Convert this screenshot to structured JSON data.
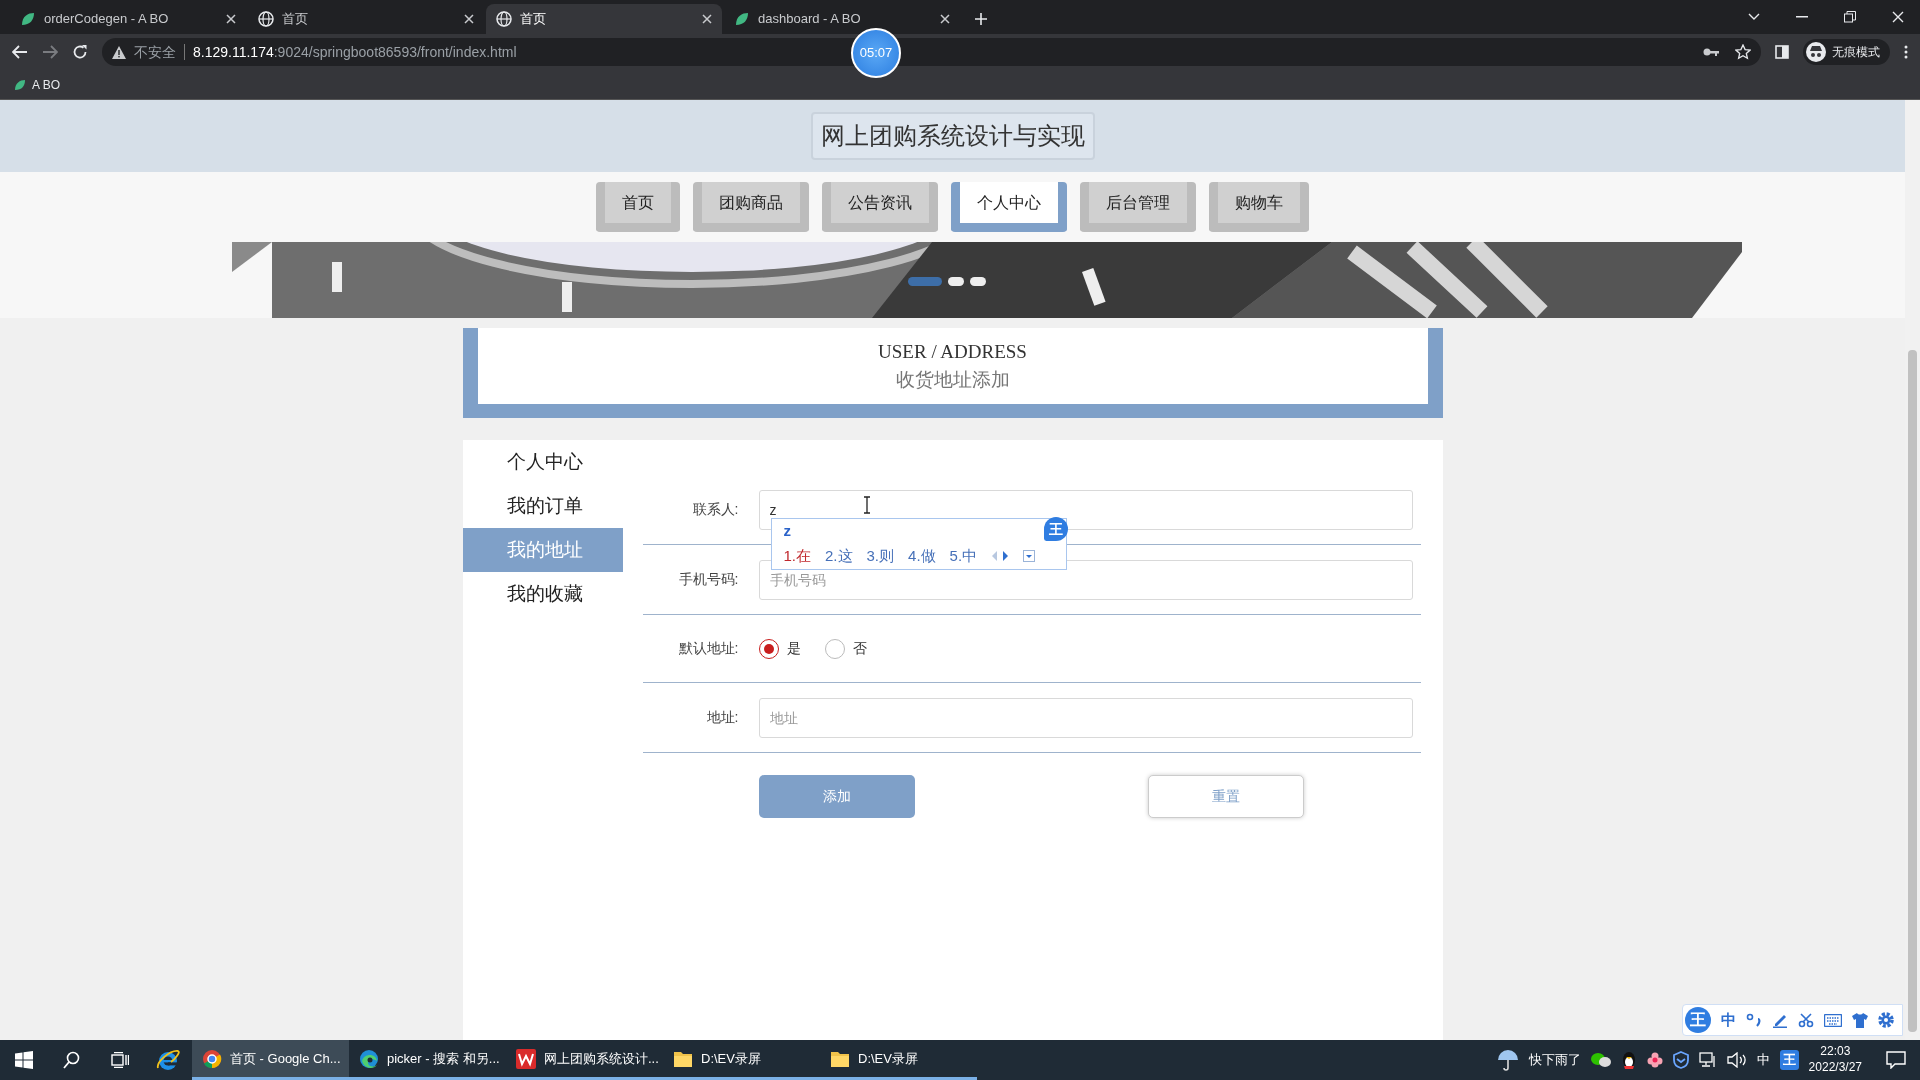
{
  "browser": {
    "tabs": [
      {
        "title": "orderCodegen - A BO",
        "kind": "app",
        "selected": false
      },
      {
        "title": "首页",
        "kind": "web",
        "selected": false
      },
      {
        "title": "首页",
        "kind": "web",
        "selected": true
      },
      {
        "title": "dashboard - A BO",
        "kind": "app",
        "selected": false
      }
    ],
    "security": "不安全",
    "url_host": "8.129.11.174",
    "url_path": ":9024/springboot86593/front/index.html",
    "timer": "05:07",
    "profile": "无痕模式",
    "bookmarks": [
      "A BO"
    ]
  },
  "site_title": "网上团购系统设计与实现",
  "nav": [
    {
      "label": "首页",
      "selected": false
    },
    {
      "label": "团购商品",
      "selected": false
    },
    {
      "label": "公告资讯",
      "selected": false
    },
    {
      "label": "个人中心",
      "selected": true
    },
    {
      "label": "后台管理",
      "selected": false
    },
    {
      "label": "购物车",
      "selected": false
    }
  ],
  "carousel_dots": [
    {
      "selected": true
    },
    {
      "selected": false
    },
    {
      "selected": false
    }
  ],
  "section": {
    "title_en": "USER / ADDRESS",
    "title_cn": "收货地址添加"
  },
  "sidebar": [
    {
      "label": "个人中心",
      "selected": false
    },
    {
      "label": "我的订单",
      "selected": false
    },
    {
      "label": "我的地址",
      "selected": true
    },
    {
      "label": "我的收藏",
      "selected": false
    }
  ],
  "form": [
    {
      "kind": "input",
      "label": "联系人:",
      "value": "z"
    },
    {
      "kind": "input",
      "label": "手机号码:",
      "placeholder": "手机号码"
    },
    {
      "kind": "radio",
      "label": "默认地址:",
      "options": [
        {
          "label": "是",
          "selected": true
        },
        {
          "label": "否",
          "selected": false
        }
      ]
    },
    {
      "kind": "input",
      "label": "地址:",
      "placeholder": "地址"
    }
  ],
  "buttons": [
    {
      "label": "添加",
      "kind": "primary"
    },
    {
      "label": "重置",
      "kind": "outline"
    }
  ],
  "ime": {
    "composition": "z",
    "candidates": [
      {
        "label": "1.在",
        "selected": true
      },
      {
        "label": "2.这",
        "selected": false
      },
      {
        "label": "3.则",
        "selected": false
      },
      {
        "label": "4.做",
        "selected": false
      },
      {
        "label": "5.中",
        "selected": false
      }
    ],
    "logo": "王"
  },
  "ime_toolbar": {
    "logo": "王",
    "mode": "中"
  },
  "taskbar": {
    "apps": [
      {
        "label": "首页 - Google Ch...",
        "active": true
      },
      {
        "label": "picker - 搜索 和另...",
        "active": false
      },
      {
        "label": "网上团购系统设计...",
        "active": false
      },
      {
        "label": "D:\\EV录屏",
        "kind": "folder",
        "active": false
      },
      {
        "label": "D:\\EV录屏",
        "kind": "folder",
        "active": false
      }
    ],
    "weather": "快下雨了",
    "input_mode": "中",
    "ime_logo": "王",
    "time": "22:03",
    "date": "2022/3/27"
  }
}
